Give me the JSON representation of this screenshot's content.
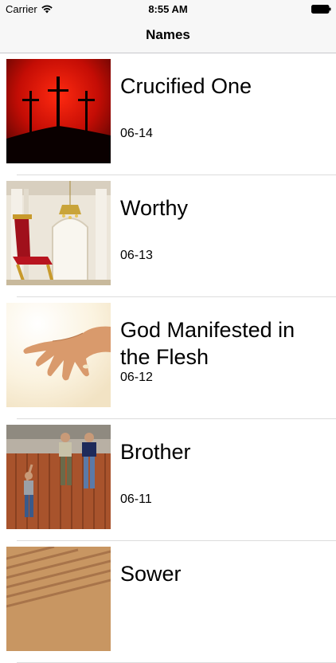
{
  "status_bar": {
    "carrier": "Carrier",
    "time": "8:55 AM"
  },
  "nav": {
    "title": "Names"
  },
  "items": [
    {
      "title": "Crucified One",
      "date": "06-14",
      "image": "three-crosses-red-sky"
    },
    {
      "title": "Worthy",
      "date": "06-13",
      "image": "red-throne-chandelier"
    },
    {
      "title": "God Manifested in the Flesh",
      "date": "06-12",
      "image": "outstretched-hand"
    },
    {
      "title": "Brother",
      "date": "06-11",
      "image": "children-climbing-fence"
    },
    {
      "title": "Sower",
      "date": "",
      "image": "plowed-field"
    }
  ]
}
